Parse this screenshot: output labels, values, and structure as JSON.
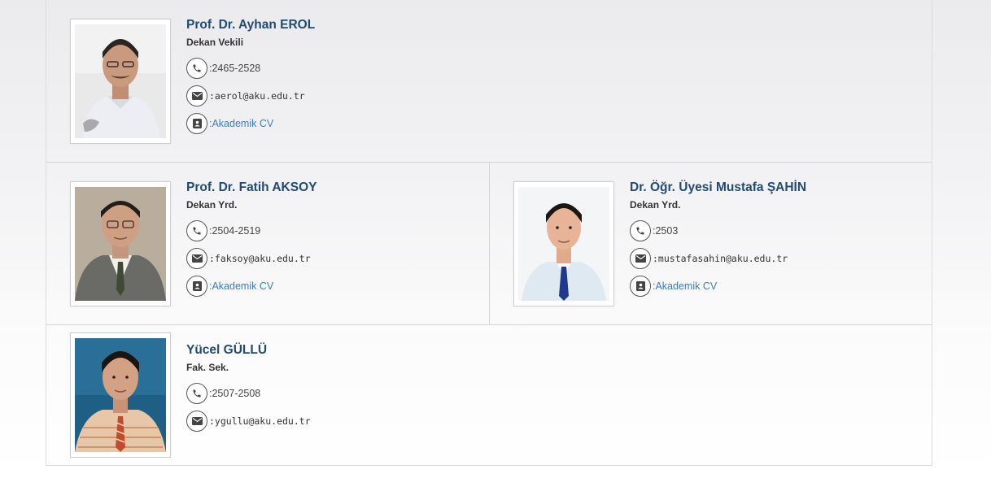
{
  "staff": [
    {
      "name": "Prof. Dr. Ayhan EROL",
      "role": "Dekan Vekili",
      "phone": ":2465-2528",
      "email": ":aerol@aku.edu.tr",
      "cv": ":Akademik CV"
    },
    {
      "name": "Prof. Dr. Fatih AKSOY",
      "role": "Dekan Yrd.",
      "phone": ":2504-2519",
      "email": ":faksoy@aku.edu.tr",
      "cv": ":Akademik CV"
    },
    {
      "name": "Dr. Öğr. Üyesi Mustafa ŞAHİN",
      "role": "Dekan Yrd.",
      "phone": ":2503",
      "email": ":mustafasahin@aku.edu.tr",
      "cv": ":Akademik CV"
    },
    {
      "name": "Yücel GÜLLÜ",
      "role": "Fak. Sek.",
      "phone": ":2507-2508",
      "email": ":ygullu@aku.edu.tr"
    }
  ],
  "icons": {
    "phone": "phone-icon",
    "email": "envelope-icon",
    "cv": "contact-card-icon"
  },
  "colors": {
    "name": "#234a72",
    "link": "#3d7cc0"
  }
}
